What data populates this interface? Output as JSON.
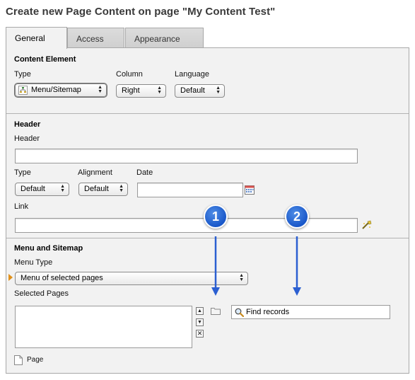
{
  "title": "Create new Page Content on page \"My Content Test\"",
  "tabs": [
    {
      "label": "General",
      "active": true
    },
    {
      "label": "Access",
      "active": false
    },
    {
      "label": "Appearance",
      "active": false
    }
  ],
  "content_element": {
    "title": "Content Element",
    "type_label": "Type",
    "type_value": "Menu/Sitemap",
    "column_label": "Column",
    "column_value": "Right",
    "language_label": "Language",
    "language_value": "Default"
  },
  "header": {
    "title": "Header",
    "header_label": "Header",
    "header_value": "",
    "type_label": "Type",
    "type_value": "Default",
    "alignment_label": "Alignment",
    "alignment_value": "Default",
    "date_label": "Date",
    "date_value": "",
    "link_label": "Link",
    "link_value": ""
  },
  "menu": {
    "title": "Menu and Sitemap",
    "menu_type_label": "Menu Type",
    "menu_type_value": "Menu of selected pages",
    "selected_pages_label": "Selected Pages",
    "find_records_placeholder": "Find records",
    "page_label": "Page"
  },
  "markers": [
    "1",
    "2"
  ],
  "colors": {
    "marker": "#1957c9",
    "panel_bg": "#f2f2f2",
    "arrow": "#2b5fd1"
  }
}
